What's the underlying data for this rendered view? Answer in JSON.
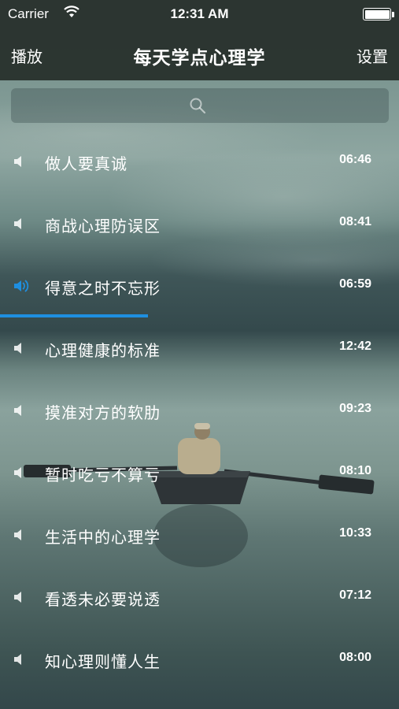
{
  "status_bar": {
    "carrier": "Carrier",
    "time": "12:31 AM",
    "wifi_icon": "wifi-icon",
    "battery_icon": "battery-icon"
  },
  "nav": {
    "left_label": "播放",
    "title": "每天学点心理学",
    "right_label": "设置"
  },
  "search": {
    "icon": "search-icon",
    "placeholder": ""
  },
  "playback": {
    "active_index": 2,
    "progress_fraction": 0.37,
    "accent_color": "#1e8fe0"
  },
  "tracks": [
    {
      "title": "做人要真诚",
      "duration": "06:46"
    },
    {
      "title": "商战心理防误区",
      "duration": "08:41"
    },
    {
      "title": "得意之时不忘形",
      "duration": "06:59"
    },
    {
      "title": "心理健康的标准",
      "duration": "12:42"
    },
    {
      "title": "摸准对方的软肋",
      "duration": "09:23"
    },
    {
      "title": "暂时吃亏不算亏",
      "duration": "08:10"
    },
    {
      "title": "生活中的心理学",
      "duration": "10:33"
    },
    {
      "title": "看透未必要说透",
      "duration": "07:12"
    },
    {
      "title": "知心理则懂人生",
      "duration": "08:00"
    }
  ]
}
